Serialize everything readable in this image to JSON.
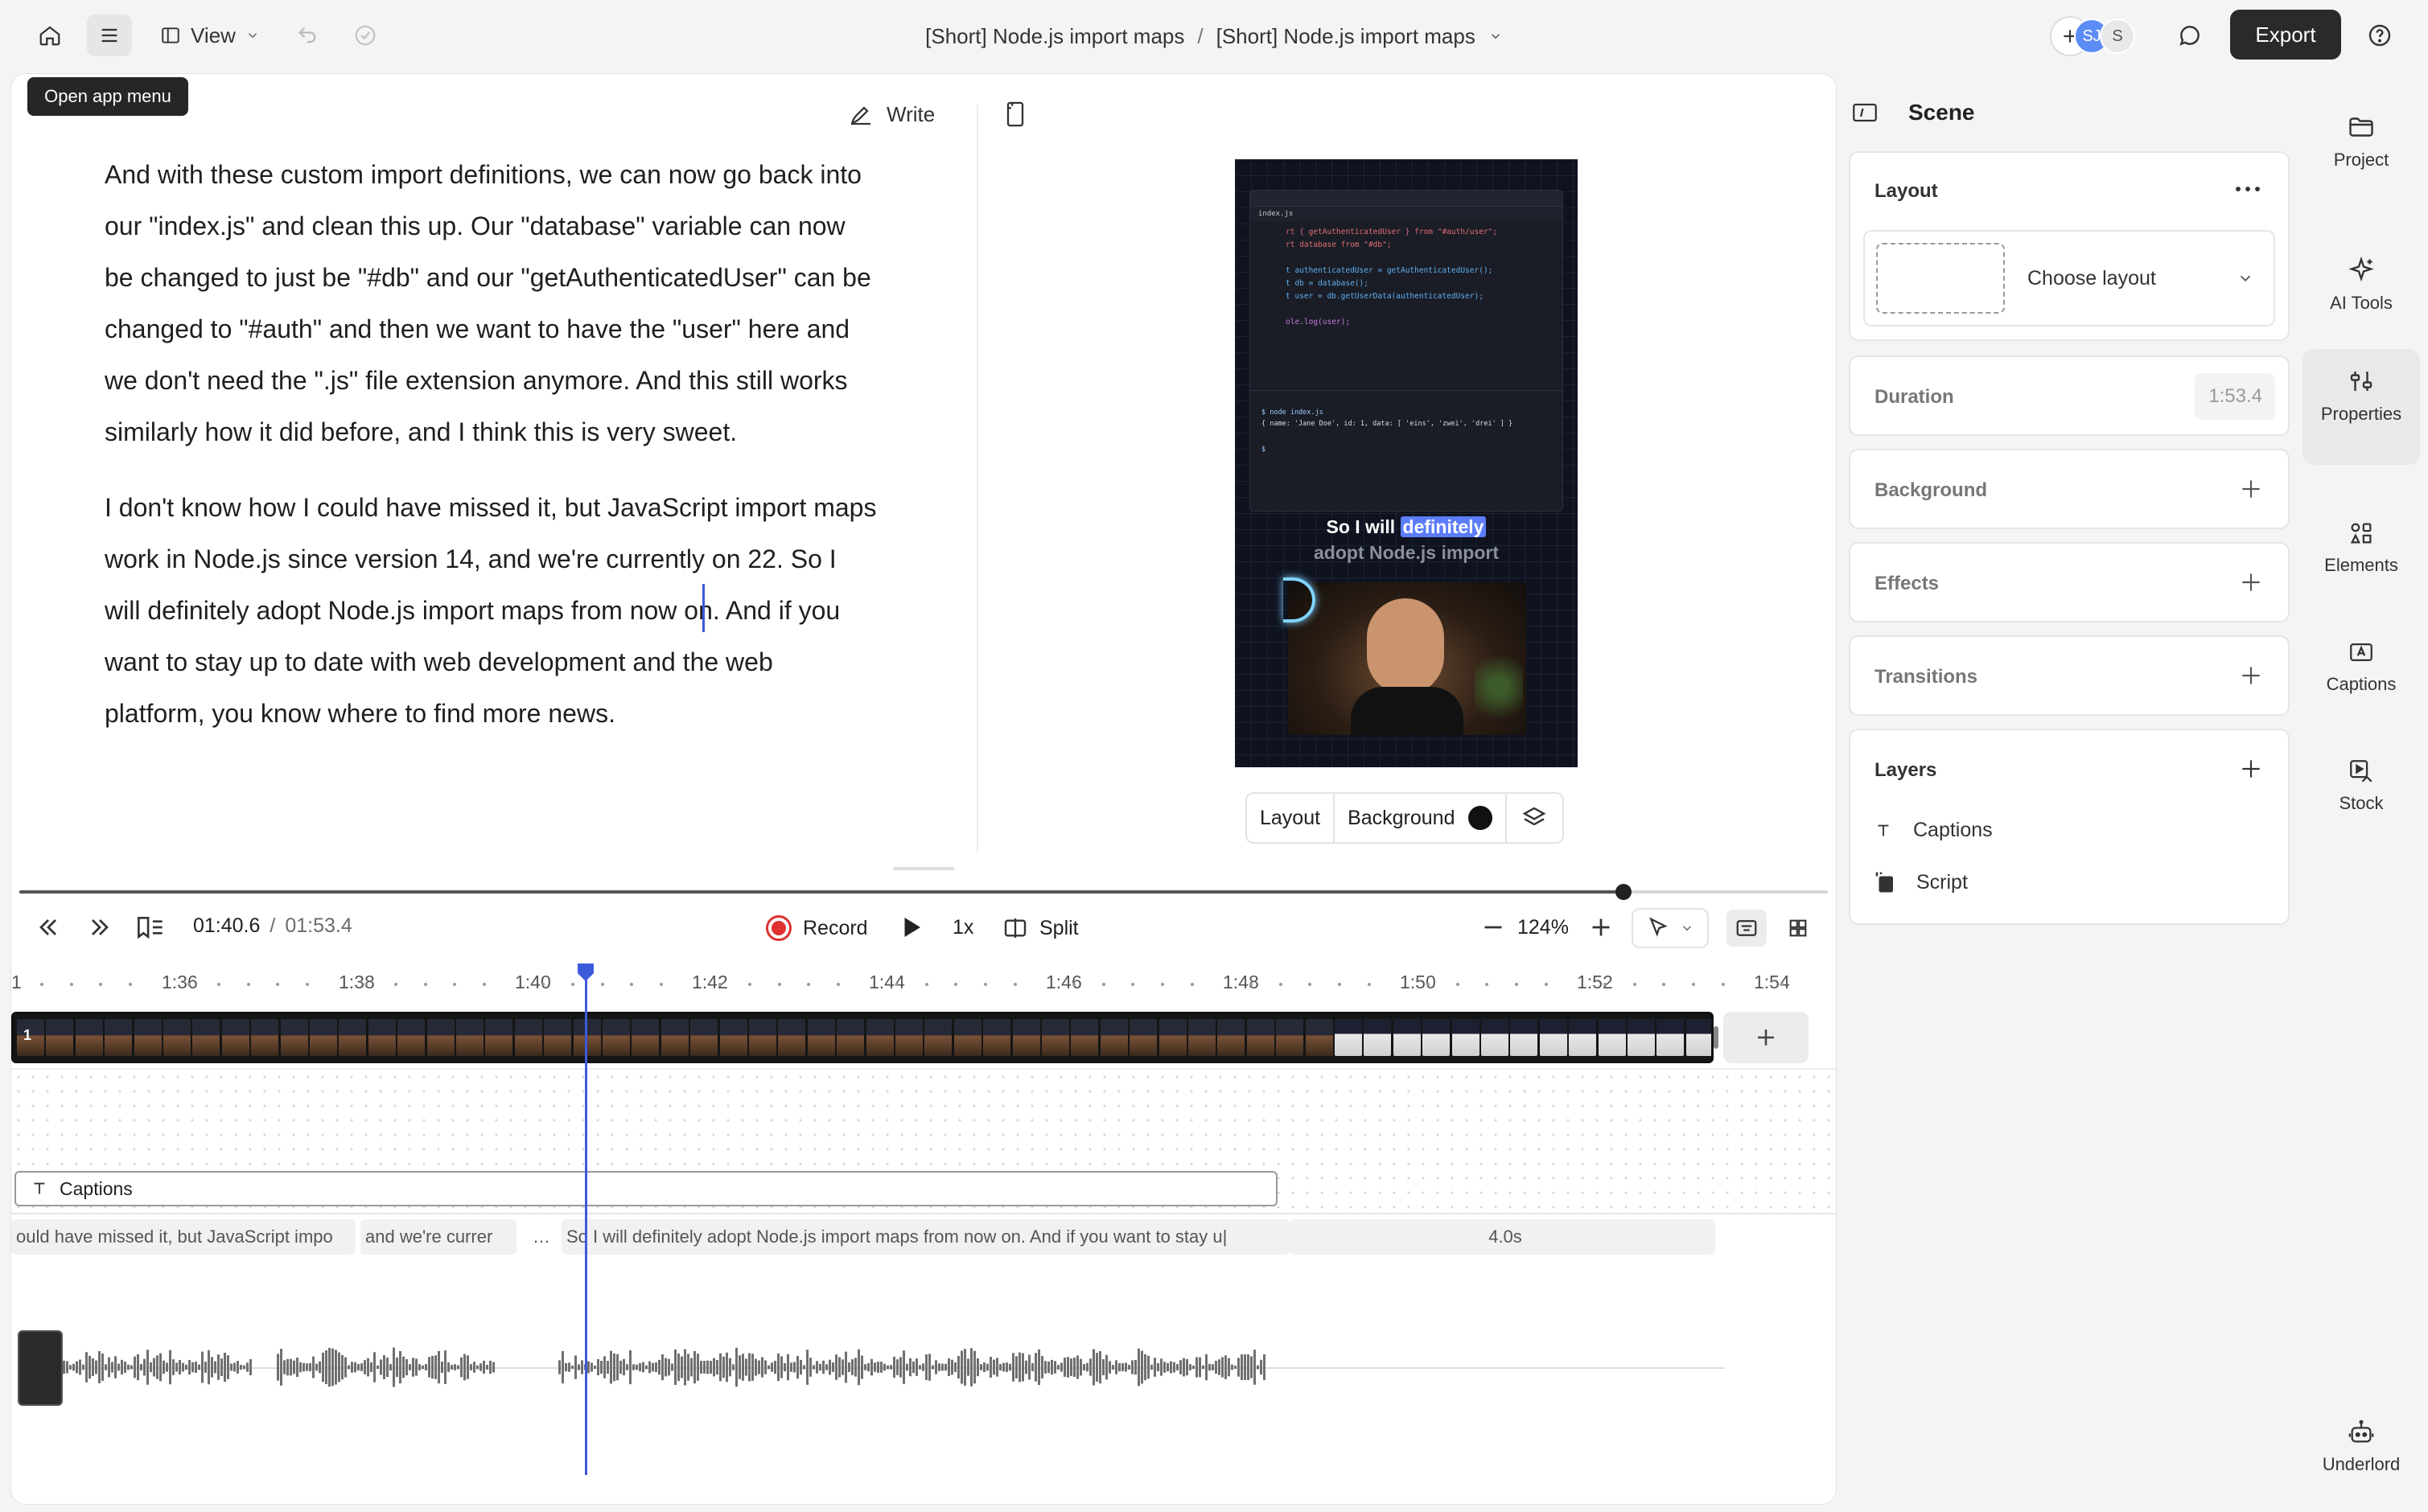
{
  "topbar": {
    "view_label": "View",
    "crumb_project": "[Short] Node.js import maps",
    "crumb_separator": "/",
    "crumb_composition": "[Short] Node.js import maps",
    "avatar_initials": "SJ",
    "avatar_s": "S",
    "export_label": "Export"
  },
  "tooltip": "Open app menu",
  "script_editor": {
    "write_label": "Write",
    "paragraphs": [
      "And with these custom import definitions, we can now go back into our \"index.js\" and clean this up. Our \"database\" variable can now be changed to just be \"#db\" and our \"getAuthenticatedUser\" can be changed to \"#auth\" and then we want to have the \"user\" here and we don't need the \".js\" file extension anymore. And this still works similarly how it did before, and I think this is very sweet.",
      "I don't know how I could have missed it, but JavaScript import maps work in Node.js since version 14, and we're currently on 22. So I will definitely adopt Node.js import maps from now on. And if you want to stay up to date with web development and the web platform, you know where to find more news."
    ]
  },
  "preview": {
    "caption_line1_pre": "So I will ",
    "caption_line1_highlight": "definitely",
    "caption_line2": "adopt Node.js import",
    "code_tab": "index.js",
    "code_lines": [
      "rt { getAuthenticatedUser } from \"#auth/user\";",
      "rt database from \"#db\";",
      "",
      "t authenticatedUser = getAuthenticatedUser();",
      "t db = database();",
      "t user = db.getUserData(authenticatedUser);",
      "",
      "ole.log(user);"
    ],
    "terminal_lines": [
      "$ node index.js",
      "{ name: 'Jane Doe', id: 1, data: [ 'eins', 'zwei', 'drei' ] }",
      "$"
    ],
    "toolbar": {
      "layout_label": "Layout",
      "background_label": "Background",
      "background_color": "#111111"
    }
  },
  "timeline": {
    "current_time": "01:40.6",
    "separator": "/",
    "total_time": "01:53.4",
    "record_label": "Record",
    "speed_label": "1x",
    "split_label": "Split",
    "zoom_label": "124%",
    "progress": 0.887,
    "ruler_labels": [
      "1:36",
      "1:38",
      "1:40",
      "1:42",
      "1:44",
      "1:46",
      "1:48",
      "1:50",
      "1:52",
      "1:54"
    ],
    "ruler_partial": "1",
    "clip_index": "1",
    "captions_track_label": "Captions",
    "caption_segments": [
      "ould have missed it, but JavaScript impo",
      "and we're currer",
      "…",
      "So I will definitely adopt Node.js import maps from now on. And if you want to stay u|"
    ],
    "gap_duration": "4.0s"
  },
  "right_panel": {
    "title": "Scene",
    "layout": {
      "title": "Layout",
      "choose_label": "Choose layout"
    },
    "duration": {
      "title": "Duration",
      "value": "1:53.4"
    },
    "background": {
      "title": "Background"
    },
    "effects": {
      "title": "Effects"
    },
    "transitions": {
      "title": "Transitions"
    },
    "layers": {
      "title": "Layers",
      "items": [
        "Captions",
        "Script"
      ]
    }
  },
  "nav": {
    "project": "Project",
    "ai_tools": "AI Tools",
    "properties": "Properties",
    "elements": "Elements",
    "captions": "Captions",
    "stock": "Stock",
    "underlord": "Underlord"
  },
  "colors": {
    "accent": "#3b5bdb",
    "record": "#e03131",
    "caption_highlight": "#5c7cfa"
  }
}
